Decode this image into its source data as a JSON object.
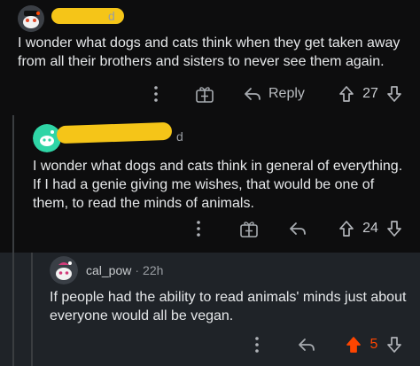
{
  "comments": [
    {
      "username": "",
      "timestamp": "d",
      "body": "I wonder what dogs and cats think when they get taken away from all their brothers and sisters to never see them again.",
      "actions": {
        "reply_label": "Reply",
        "votes": "27"
      }
    },
    {
      "username": "",
      "timestamp": "d",
      "body": "I wonder what dogs and cats think in general of everything. If I had a genie giving me wishes, that would be one of them, to read the minds of animals.",
      "actions": {
        "votes": "24"
      }
    },
    {
      "username": "cal_pow",
      "separator": "·",
      "timestamp": "22h",
      "body": "If people had the ability to read animals' minds just about everyone would all be vegan.",
      "actions": {
        "votes": "5",
        "upvoted": true
      }
    }
  ],
  "colors": {
    "background": "#0d0d0e",
    "nested_background": "#1f2328",
    "upvote_active": "#ff4500",
    "redaction": "#f5c518"
  },
  "icons": [
    "more-vertical-icon",
    "award-gift-icon",
    "reply-arrow-icon",
    "upvote-arrow-icon",
    "downvote-arrow-icon"
  ]
}
